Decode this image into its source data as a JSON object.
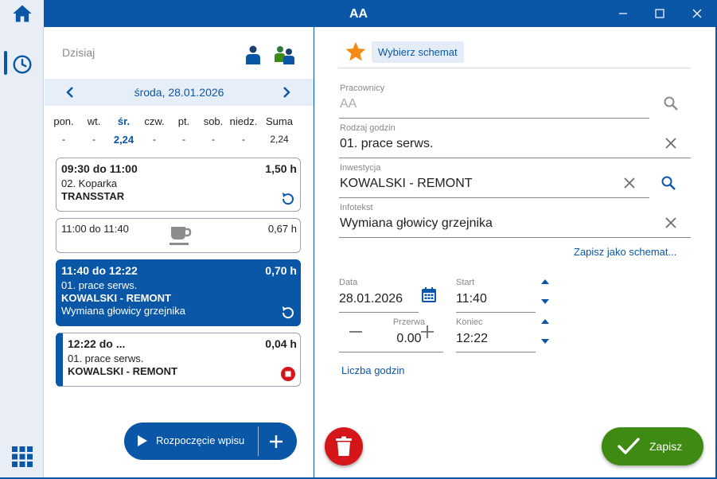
{
  "window": {
    "title": "AA"
  },
  "colors": {
    "primary": "#0b57a7",
    "danger": "#d4161b",
    "success": "#3e8a12"
  },
  "sidebar": {
    "icons": [
      "home-icon",
      "clock-icon",
      "grid-icon"
    ]
  },
  "left": {
    "today_label": "Dzisiaj",
    "current_date": "środa, 28.01.2026",
    "week_headers": [
      "pon.",
      "wt.",
      "śr.",
      "czw.",
      "pt.",
      "sob.",
      "niedz.",
      "Suma"
    ],
    "week_values": [
      "-",
      "-",
      "2,24",
      "-",
      "-",
      "-",
      "-",
      "2,24"
    ],
    "entries": [
      {
        "time": "09:30 do 11:00",
        "hours": "1,50 h",
        "line1": "02. Koparka",
        "line2": "TRANSSTAR"
      },
      {
        "time": "11:00 do 11:40",
        "hours": "0,67 h"
      },
      {
        "time": "11:40 do 12:22",
        "hours": "0,70 h",
        "line1": "01. prace serws.",
        "line2": "KOWALSKI - REMONT",
        "line3": "Wymiana głowicy grzejnika"
      },
      {
        "time": "12:22 do ...",
        "hours": "0,04 h",
        "line1": "01. prace serws.",
        "line2": "KOWALSKI - REMONT"
      }
    ],
    "start_button": "Rozpoczęcie wpisu"
  },
  "right": {
    "schema_button": "Wybierz schemat",
    "employees": {
      "label": "Pracownicy",
      "value": "AA"
    },
    "hours_type": {
      "label": "Rodzaj godzin",
      "value": "01. prace serws."
    },
    "investment": {
      "label": "Inwestycja",
      "value": "KOWALSKI - REMONT"
    },
    "infotext": {
      "label": "Infotekst",
      "value": "Wymiana głowicy grzejnika"
    },
    "save_as_schema": "Zapisz jako schemat...",
    "date": {
      "label": "Data",
      "value": "28.01.2026"
    },
    "start": {
      "label": "Start",
      "value": "11:40"
    },
    "break": {
      "label": "Przerwa",
      "value": "0.00"
    },
    "end": {
      "label": "Koniec",
      "value": "12:22"
    },
    "hours_count_link": "Liczba godzin",
    "save_button": "Zapisz"
  }
}
